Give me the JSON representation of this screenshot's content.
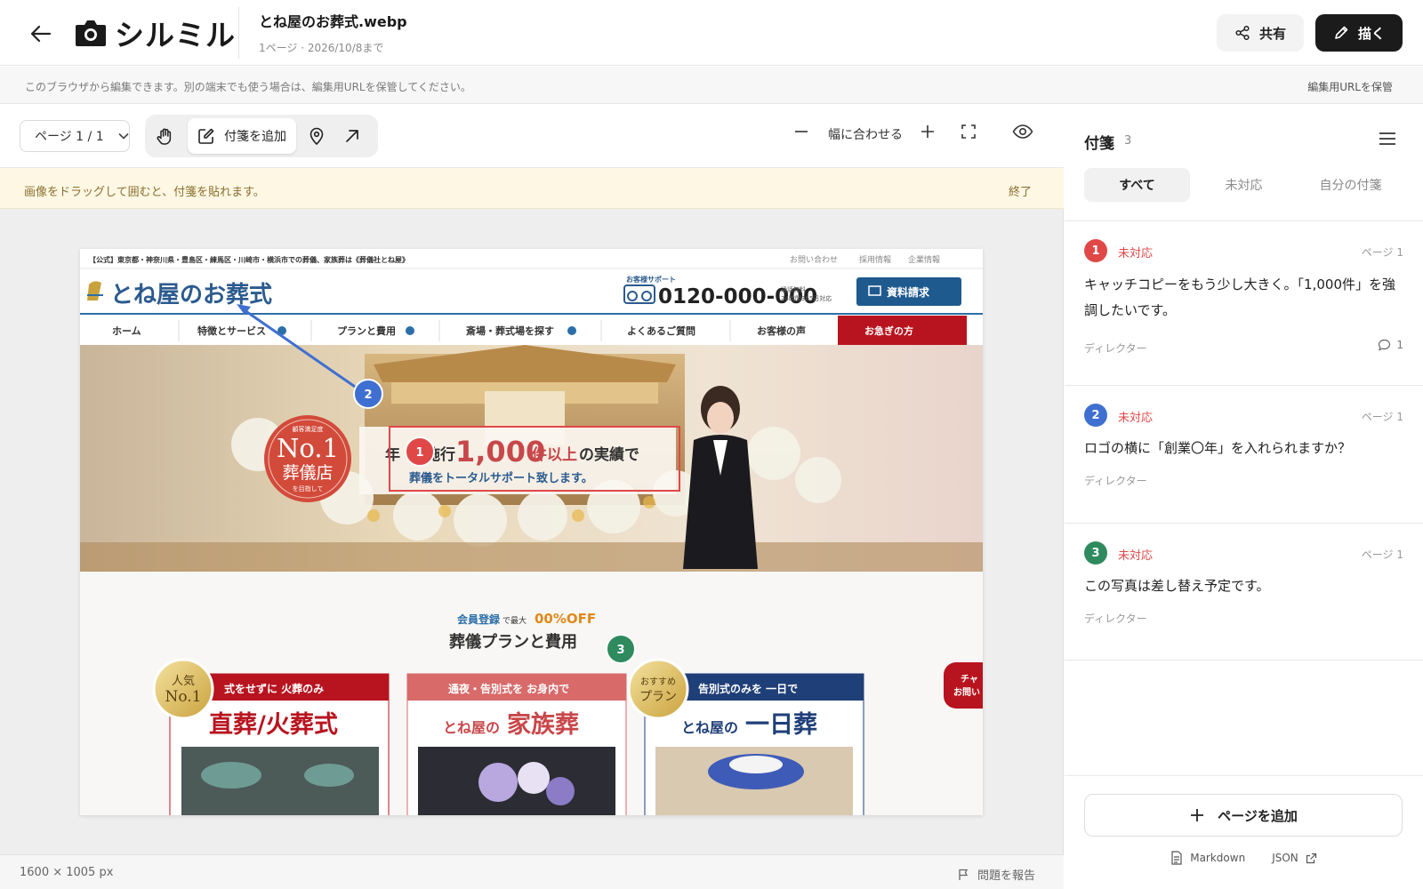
{
  "header": {
    "brand": "シルミル",
    "file_name": "とね屋のお葬式.webp",
    "file_meta": "1ページ · 2026/10/8まで",
    "share_label": "共有",
    "draw_label": "描く"
  },
  "notice": {
    "text": "このブラウザから編集できます。別の端末でも使う場合は、編集用URLを保管してください。",
    "save_url_label": "編集用URLを保管"
  },
  "toolbar": {
    "page_select": "ページ 1 / 1",
    "add_note_label": "付箋を追加",
    "fit_label": "幅に合わせる"
  },
  "hint": {
    "text": "画像をドラッグして囲むと、付箋を貼れます。",
    "end_label": "終了"
  },
  "status": {
    "dimensions": "1600 × 1005 px",
    "report_label": "問題を報告"
  },
  "site": {
    "topbar_text": "【公式】東京都・神奈川県・豊島区・練馬区・川崎市・横浜市での葬儀、家族葬は《葬儀社とね屋》",
    "toplinks": [
      "お問い合わせ",
      "採用情報",
      "企業情報"
    ],
    "logo": "とね屋のお葬式",
    "support_label": "お客様サポート",
    "phone": "0120-000-000",
    "phone_note1": "通話無料",
    "phone_note2": "24時間365日対応",
    "request_button": "資料請求",
    "nav": [
      "ホーム",
      "特徴とサービス",
      "プランと費用",
      "斎場・葬式場を探す",
      "よくあるご質問",
      "お客様の声",
      "お急ぎの方"
    ],
    "hero_badge_top": "顧客満足度",
    "hero_badge_main1": "No.1",
    "hero_badge_main2": "葬儀店",
    "hero_badge_bottom": "を目指して",
    "hero_line1_a": "年",
    "hero_line1_b": "施行",
    "hero_big": "1,000",
    "hero_line1_c": "件以上",
    "hero_line1_d": "の実績で",
    "hero_line2": "葬儀をトータルサポート致します。",
    "promo_a": "会員登録",
    "promo_b": "で最大",
    "promo_c": "00%OFF",
    "section_title": "葬儀プランと費用",
    "plans": [
      {
        "ribbon": "式をせずに 火葬のみ",
        "title": "直葬/火葬式"
      },
      {
        "ribbon": "通夜・告別式を お身内で",
        "title_pre": "とね屋の",
        "title": "家族葬"
      },
      {
        "ribbon": "告別式のみを 一日で",
        "title_pre": "とね屋の",
        "title": "一日葬"
      }
    ],
    "badge_popular1": "人気",
    "badge_popular2": "No.1",
    "badge_rec1": "おすすめ",
    "badge_rec2": "プラン",
    "side_tab1": "チャ",
    "side_tab2": "お問い"
  },
  "sidebar": {
    "title": "付箋",
    "count": "3",
    "tabs": [
      "すべて",
      "未対応",
      "自分の付箋"
    ],
    "notes": [
      {
        "num": "1",
        "status": "未対応",
        "page": "ページ 1",
        "text": "キャッチコピーをもう少し大きく。「1,000件」を強調したいです。",
        "author": "ディレクター",
        "comments": "1",
        "color": "#e04848"
      },
      {
        "num": "2",
        "status": "未対応",
        "page": "ページ 1",
        "text": "ロゴの横に「創業〇年」を入れられますか？",
        "author": "ディレクター",
        "color": "#3f6fd1"
      },
      {
        "num": "3",
        "status": "未対応",
        "page": "ページ 1",
        "text": "この写真は差し替え予定です。",
        "author": "ディレクター",
        "color": "#2f8a5e"
      }
    ],
    "add_page_label": "ページを追加",
    "export_markdown": "Markdown",
    "export_json": "JSON"
  }
}
